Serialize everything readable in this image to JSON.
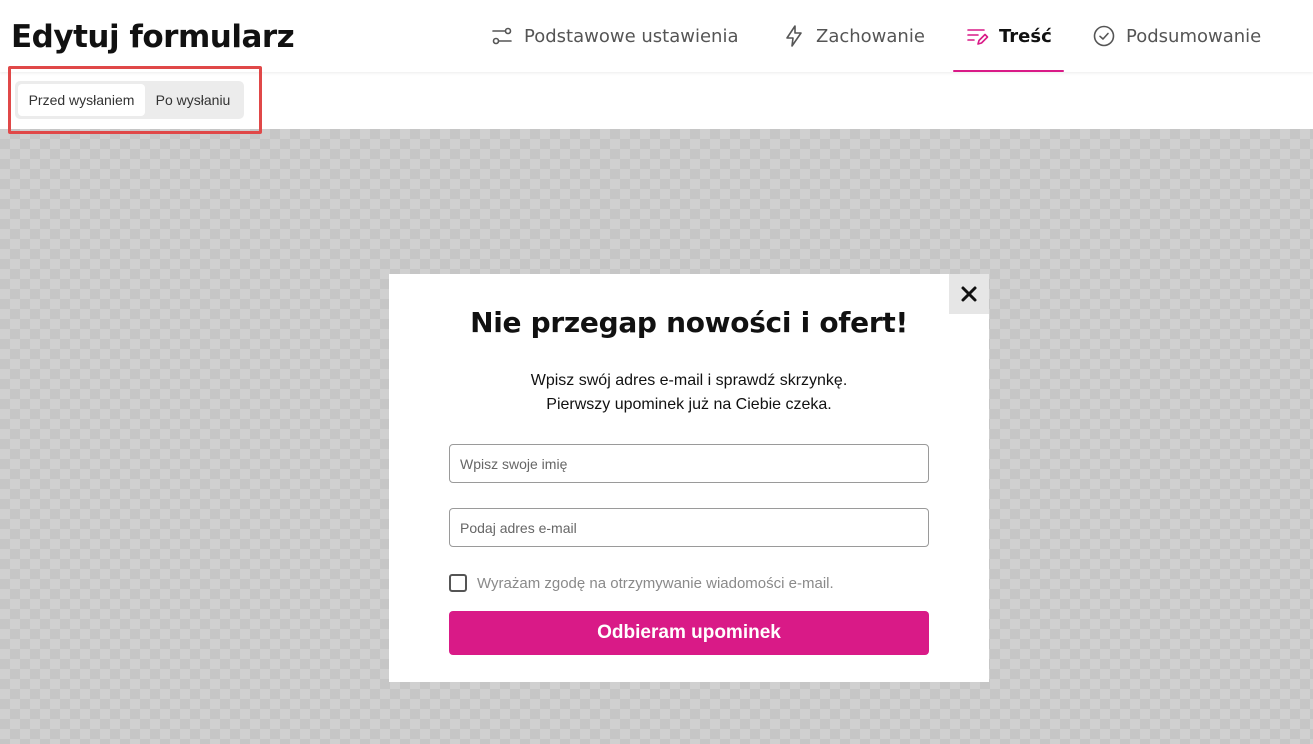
{
  "header": {
    "title": "Edytuj formularz",
    "tabs": [
      {
        "label": "Podstawowe ustawienia",
        "icon": "sliders-icon",
        "active": false
      },
      {
        "label": "Zachowanie",
        "icon": "lightning-icon",
        "active": false
      },
      {
        "label": "Treść",
        "icon": "content-edit-icon",
        "active": true
      },
      {
        "label": "Podsumowanie",
        "icon": "check-circle-icon",
        "active": false
      }
    ]
  },
  "toggle": {
    "options": [
      "Przed wysłaniem",
      "Po wysłaniu"
    ],
    "selected": "Przed wysłaniem"
  },
  "popup": {
    "title": "Nie przegap nowości i ofert!",
    "subtitle_line1": "Wpisz swój adres e-mail i sprawdź skrzynkę.",
    "subtitle_line2": "Pierwszy upominek już na Ciebie czeka.",
    "name_placeholder": "Wpisz swoje imię",
    "email_placeholder": "Podaj adres e-mail",
    "consent_label": "Wyrażam zgodę na otrzymywanie wiadomości e-mail.",
    "submit_label": "Odbieram upominek",
    "close_icon": "close-icon"
  },
  "colors": {
    "accent": "#d91a87",
    "highlight": "#e04848",
    "tab_inactive": "#555555"
  }
}
